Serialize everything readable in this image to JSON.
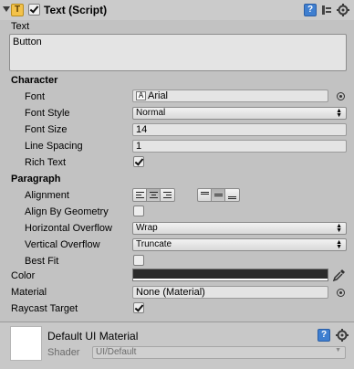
{
  "component": {
    "title": "Text (Script)",
    "enabled": true,
    "icon_letter": "T"
  },
  "text": {
    "label": "Text",
    "value": "Button"
  },
  "character": {
    "header": "Character",
    "font_label": "Font",
    "font_value": "Arial",
    "font_style_label": "Font Style",
    "font_style_value": "Normal",
    "font_size_label": "Font Size",
    "font_size_value": "14",
    "line_spacing_label": "Line Spacing",
    "line_spacing_value": "1",
    "rich_text_label": "Rich Text",
    "rich_text_checked": true
  },
  "paragraph": {
    "header": "Paragraph",
    "alignment_label": "Alignment",
    "horizontal_alignment_selected": "center",
    "vertical_alignment_selected": "middle",
    "align_by_geometry_label": "Align By Geometry",
    "align_by_geometry_checked": false,
    "horizontal_overflow_label": "Horizontal Overflow",
    "horizontal_overflow_value": "Wrap",
    "vertical_overflow_label": "Vertical Overflow",
    "vertical_overflow_value": "Truncate",
    "best_fit_label": "Best Fit",
    "best_fit_checked": false
  },
  "color": {
    "label": "Color",
    "value": "#2a2a2a"
  },
  "material": {
    "label": "Material",
    "value": "None (Material)"
  },
  "raycast": {
    "label": "Raycast Target",
    "checked": true
  },
  "default_material": {
    "title": "Default UI Material",
    "shader_label": "Shader",
    "shader_value": "UI/Default"
  },
  "icons": {
    "foldout": "triangle-down-icon",
    "help": "help-icon",
    "preset": "preset-icon",
    "settings": "gear-icon",
    "object_picker": "target-icon",
    "eyedropper": "eyedropper-icon"
  }
}
